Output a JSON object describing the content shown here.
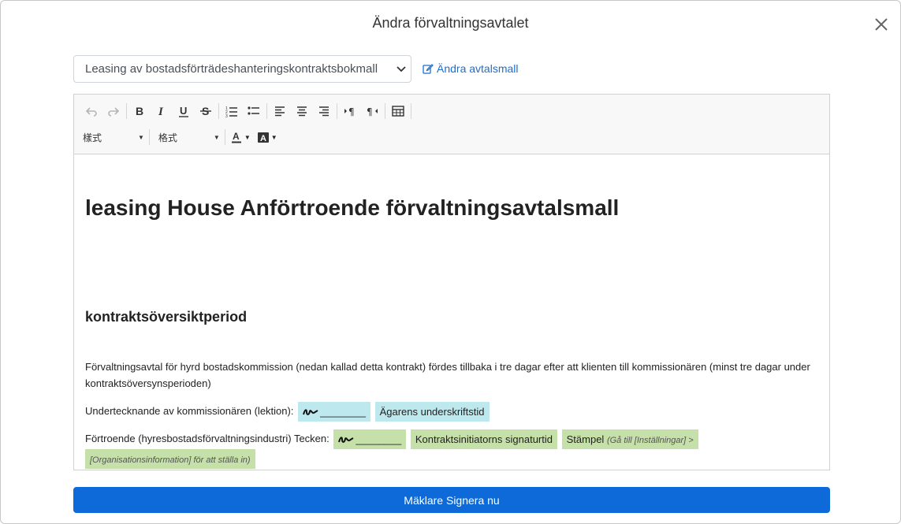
{
  "modal": {
    "title": "Ändra förvaltningsavtalet",
    "close_icon": "close-icon"
  },
  "template_select": {
    "value": "Leasing av bostadsförträdeshanteringskontraktsbokmall"
  },
  "edit_template_link": {
    "label": "Ändra avtalsmall",
    "icon": "edit-icon"
  },
  "toolbar": {
    "row1": [
      "undo-icon",
      "redo-icon",
      "bold-icon",
      "italic-icon",
      "underline-icon",
      "strikethrough-icon",
      "ordered-list-icon",
      "bullet-list-icon",
      "align-left-icon",
      "align-center-icon",
      "align-right-icon",
      "ltr-icon",
      "rtl-icon",
      "table-icon"
    ],
    "style_label": "樣式",
    "format_label": "格式",
    "text_color_label": "A",
    "bg_color_label": "A"
  },
  "document": {
    "title": "leasing House Anförtroende förvaltningsavtalsmall",
    "subtitle": "kontraktsöversiktperiod",
    "paragraph1": "Förvaltningsavtal för hyrd bostadskommission (nedan kallad detta kontrakt) fördes tillbaka i tre dagar efter att klienten till kommissionären (minst tre dagar under kontraktsöversynsperioden)",
    "paragraph2_label": "Undertecknande av kommissionären (lektion):",
    "sig_blank": "________",
    "owner_sign_time": "Ägarens underskriftstid",
    "paragraph3_label": "Förtroende (hyresbostadsförvaltningsindustri) Tecken:",
    "initiator_sign_time": "Kontraktsinitiatorns signaturtid",
    "stamp_label": "Stämpel",
    "stamp_hint": "(Gå till [Inställningar] > [Organisationsinformation] för att ställa in)"
  },
  "sign_button": {
    "label": "Mäklare Signera nu"
  },
  "colors": {
    "primary": "#0d6ad8",
    "link": "#1a6fd1",
    "tag_blue": "#bde8ee",
    "tag_green": "#c5e0a8"
  }
}
